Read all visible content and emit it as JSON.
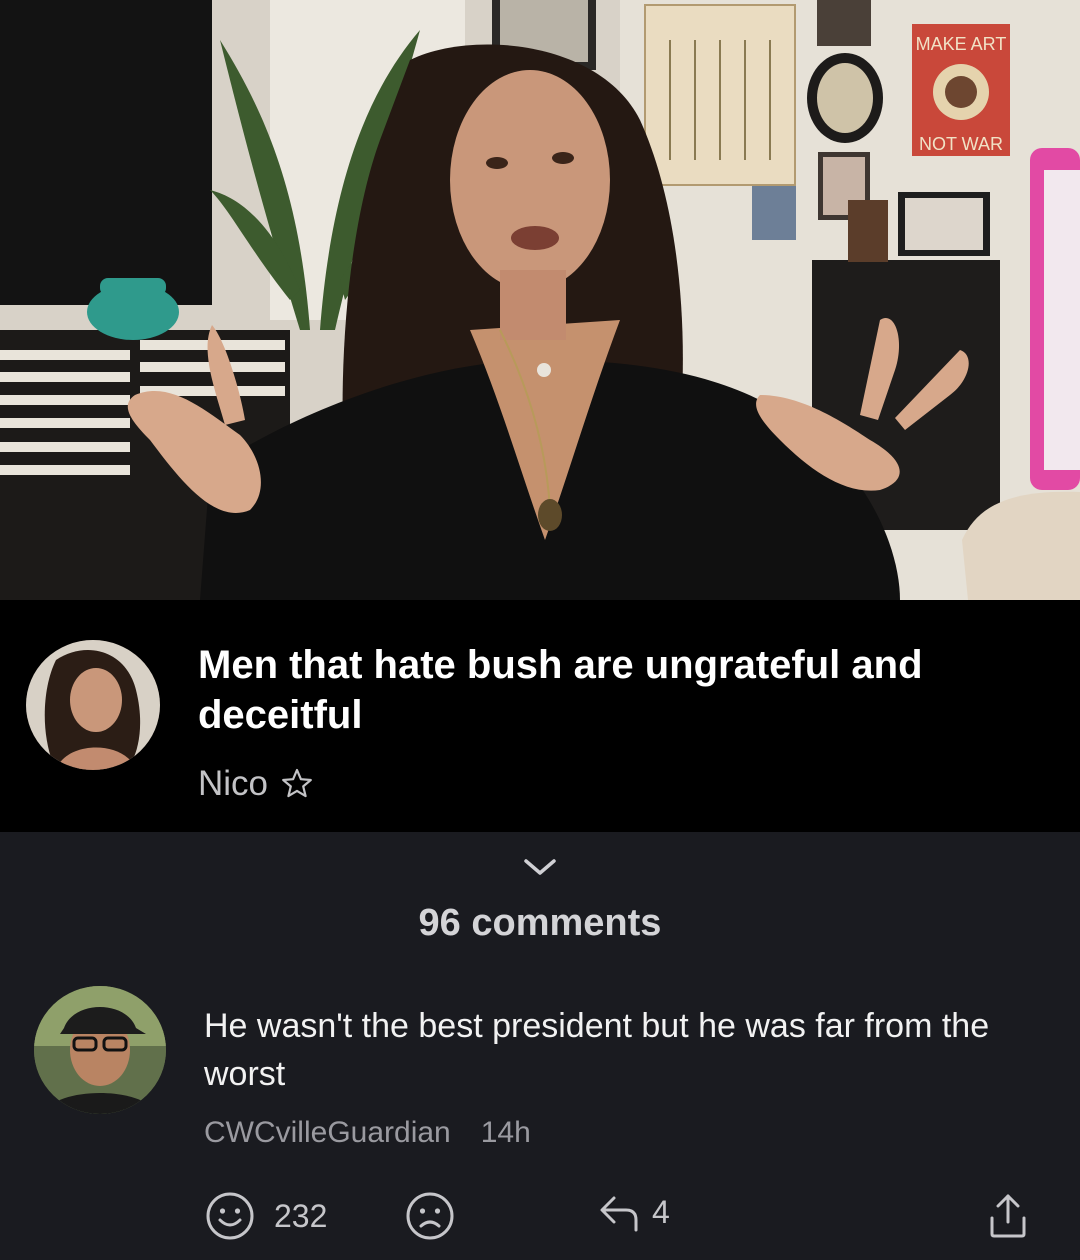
{
  "post": {
    "title": "Men that hate bush are ungrateful and deceitful",
    "author": "Nico",
    "author_badge_icon": "star-outline-icon"
  },
  "video": {
    "poster_text_top": "MAKE ART",
    "poster_text_bottom": "NOT WAR"
  },
  "comments": {
    "count_label": "96 comments",
    "collapse_icon": "chevron-down-icon",
    "items": [
      {
        "text": "He wasn't the best president but he was far from the worst",
        "author": "CWCvilleGuardian",
        "age": "14h",
        "likes": "232",
        "replies": "4"
      }
    ]
  },
  "colors": {
    "background": "#1a1b20",
    "post_band": "#000000",
    "secondary_text": "#9a9aa0"
  }
}
